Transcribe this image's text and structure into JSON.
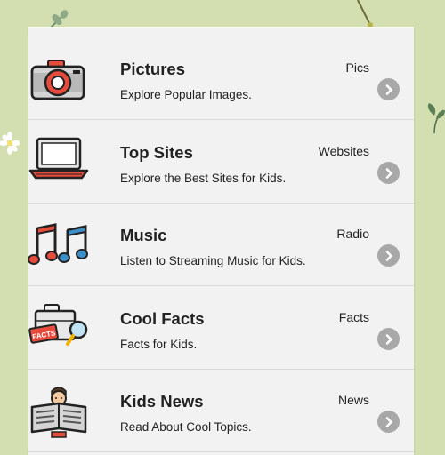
{
  "menu": [
    {
      "title": "Pictures",
      "tag": "Pics",
      "desc": "Explore Popular Images.",
      "icon": "camera-icon"
    },
    {
      "title": "Top Sites",
      "tag": "Websites",
      "desc": "Explore the Best Sites for Kids.",
      "icon": "laptop-icon"
    },
    {
      "title": "Music",
      "tag": "Radio",
      "desc": "Listen to Streaming Music for Kids.",
      "icon": "music-notes-icon"
    },
    {
      "title": "Cool Facts",
      "tag": "Facts",
      "desc": "Facts for Kids.",
      "icon": "facts-briefcase-icon",
      "icon_text": "FACTS"
    },
    {
      "title": "Kids News",
      "tag": "News",
      "desc": "Read About Cool Topics.",
      "icon": "newspaper-reader-icon"
    }
  ],
  "colors": {
    "background": "#d3dfb1",
    "panel": "#f2f2f2",
    "chevron": "#a8a8a8"
  }
}
